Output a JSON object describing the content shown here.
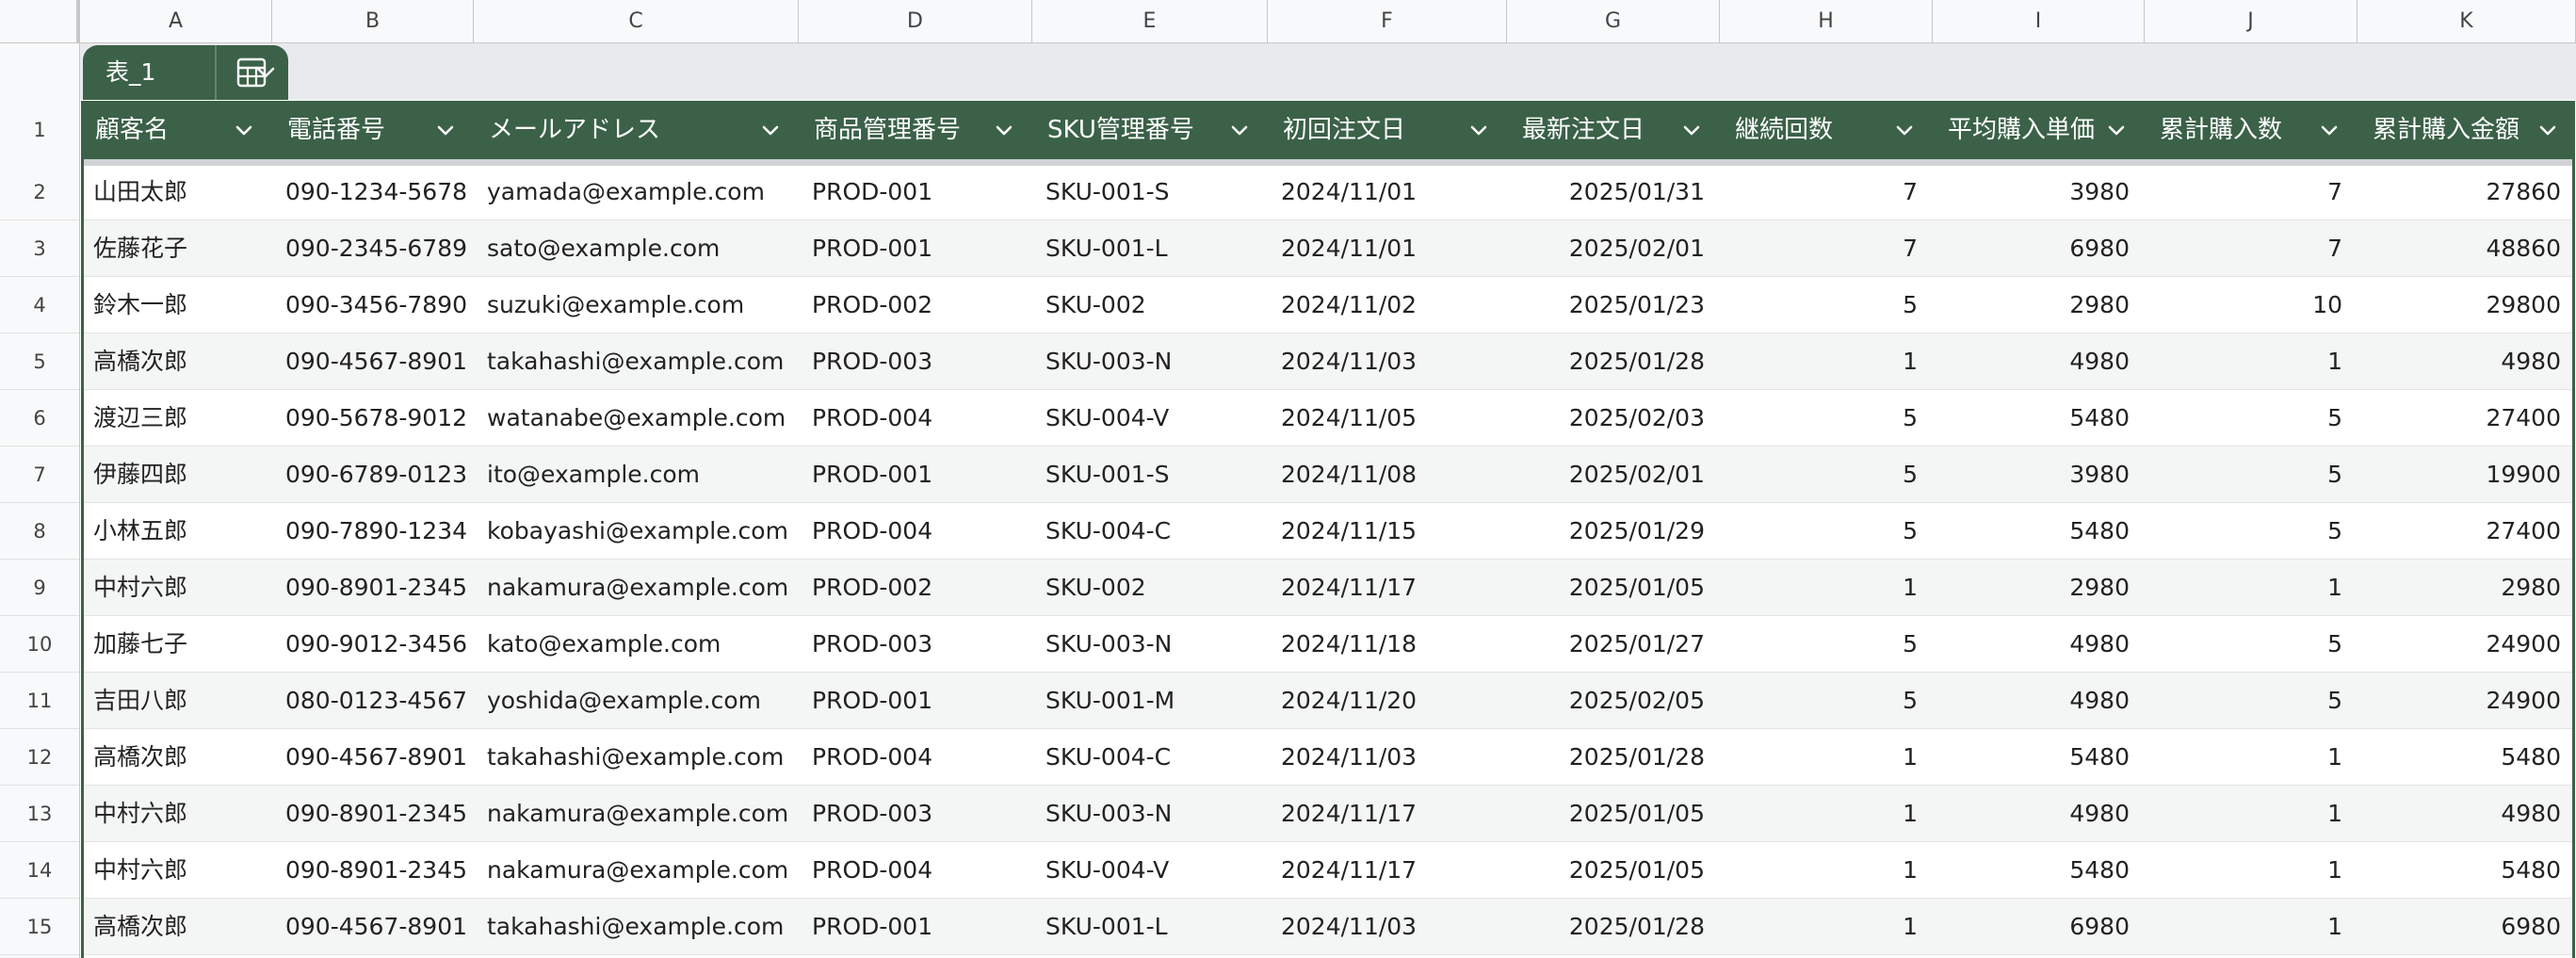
{
  "columns": [
    "A",
    "B",
    "C",
    "D",
    "E",
    "F",
    "G",
    "H",
    "I",
    "J",
    "K"
  ],
  "table_tab": {
    "name": "表_1"
  },
  "headers": [
    "顧客名",
    "電話番号",
    "メールアドレス",
    "商品管理番号",
    "SKU管理番号",
    "初回注文日",
    "最新注文日",
    "継続回数",
    "平均購入単価",
    "累計購入数",
    "累計購入金額"
  ],
  "header_row_number": "1",
  "rows": [
    {
      "num": "2",
      "cells": [
        "山田太郎",
        "090-1234-5678",
        "yamada@example.com",
        "PROD-001",
        "SKU-001-S",
        "2024/11/01",
        "2025/01/31",
        "7",
        "3980",
        "7",
        "27860"
      ]
    },
    {
      "num": "3",
      "cells": [
        "佐藤花子",
        "090-2345-6789",
        "sato@example.com",
        "PROD-001",
        "SKU-001-L",
        "2024/11/01",
        "2025/02/01",
        "7",
        "6980",
        "7",
        "48860"
      ]
    },
    {
      "num": "4",
      "cells": [
        "鈴木一郎",
        "090-3456-7890",
        "suzuki@example.com",
        "PROD-002",
        "SKU-002",
        "2024/11/02",
        "2025/01/23",
        "5",
        "2980",
        "10",
        "29800"
      ]
    },
    {
      "num": "5",
      "cells": [
        "高橋次郎",
        "090-4567-8901",
        "takahashi@example.com",
        "PROD-003",
        "SKU-003-N",
        "2024/11/03",
        "2025/01/28",
        "1",
        "4980",
        "1",
        "4980"
      ]
    },
    {
      "num": "6",
      "cells": [
        "渡辺三郎",
        "090-5678-9012",
        "watanabe@example.com",
        "PROD-004",
        "SKU-004-V",
        "2024/11/05",
        "2025/02/03",
        "5",
        "5480",
        "5",
        "27400"
      ]
    },
    {
      "num": "7",
      "cells": [
        "伊藤四郎",
        "090-6789-0123",
        "ito@example.com",
        "PROD-001",
        "SKU-001-S",
        "2024/11/08",
        "2025/02/01",
        "5",
        "3980",
        "5",
        "19900"
      ]
    },
    {
      "num": "8",
      "cells": [
        "小林五郎",
        "090-7890-1234",
        "kobayashi@example.com",
        "PROD-004",
        "SKU-004-C",
        "2024/11/15",
        "2025/01/29",
        "5",
        "5480",
        "5",
        "27400"
      ]
    },
    {
      "num": "9",
      "cells": [
        "中村六郎",
        "090-8901-2345",
        "nakamura@example.com",
        "PROD-002",
        "SKU-002",
        "2024/11/17",
        "2025/01/05",
        "1",
        "2980",
        "1",
        "2980"
      ]
    },
    {
      "num": "10",
      "cells": [
        "加藤七子",
        "090-9012-3456",
        "kato@example.com",
        "PROD-003",
        "SKU-003-N",
        "2024/11/18",
        "2025/01/27",
        "5",
        "4980",
        "5",
        "24900"
      ]
    },
    {
      "num": "11",
      "cells": [
        "吉田八郎",
        "080-0123-4567",
        "yoshida@example.com",
        "PROD-001",
        "SKU-001-M",
        "2024/11/20",
        "2025/02/05",
        "5",
        "4980",
        "5",
        "24900"
      ]
    },
    {
      "num": "12",
      "cells": [
        "高橋次郎",
        "090-4567-8901",
        "takahashi@example.com",
        "PROD-004",
        "SKU-004-C",
        "2024/11/03",
        "2025/01/28",
        "1",
        "5480",
        "1",
        "5480"
      ]
    },
    {
      "num": "13",
      "cells": [
        "中村六郎",
        "090-8901-2345",
        "nakamura@example.com",
        "PROD-003",
        "SKU-003-N",
        "2024/11/17",
        "2025/01/05",
        "1",
        "4980",
        "1",
        "4980"
      ]
    },
    {
      "num": "14",
      "cells": [
        "中村六郎",
        "090-8901-2345",
        "nakamura@example.com",
        "PROD-004",
        "SKU-004-V",
        "2024/11/17",
        "2025/01/05",
        "1",
        "5480",
        "1",
        "5480"
      ]
    },
    {
      "num": "15",
      "cells": [
        "高橋次郎",
        "090-4567-8901",
        "takahashi@example.com",
        "PROD-001",
        "SKU-001-L",
        "2024/11/03",
        "2025/01/28",
        "1",
        "6980",
        "1",
        "6980"
      ]
    }
  ],
  "icons": {
    "tab_menu": "chevron-down-icon",
    "table_view": "table-view-icon",
    "column_menu": "chevron-down-icon"
  },
  "colors": {
    "table_header": "#3b6148",
    "band": "#e8eaed"
  }
}
